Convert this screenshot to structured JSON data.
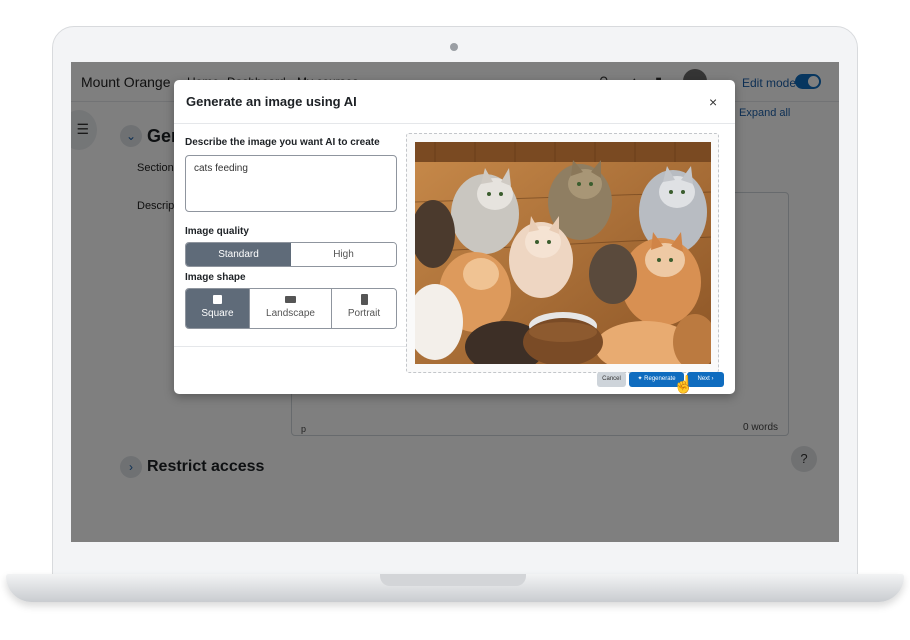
{
  "page": {
    "site_name": "Mount Orange",
    "nav": [
      "Home",
      "Dashboard",
      "My courses"
    ],
    "edit_mode_label": "Edit mode",
    "expand_all": "Expand all",
    "section_heading": "General",
    "labels": {
      "section": "Section",
      "description": "Description"
    },
    "editor": {
      "path": "p",
      "word_count": "0 words"
    },
    "restrict_access": "Restrict access",
    "help": "?"
  },
  "modal": {
    "title": "Generate an image using AI",
    "close": "×",
    "prompt_label": "Describe the image you want AI to create",
    "prompt_value": "cats feeding",
    "quality_label": "Image quality",
    "quality_options": [
      "Standard",
      "High"
    ],
    "quality_selected": "Standard",
    "shape_label": "Image shape",
    "shape_options": [
      "Square",
      "Landscape",
      "Portrait"
    ],
    "shape_selected": "Square",
    "buttons": {
      "cancel": "Cancel",
      "regenerate": "Regenerate",
      "next": "Next"
    }
  },
  "colors": {
    "accent": "#0f6cbf",
    "segment_active": "#5f6b79",
    "backdrop": "rgba(0,0,0,0.5)"
  },
  "icons": [
    "drawer-toggle-icon",
    "search-icon",
    "notifications-icon",
    "messages-icon",
    "close-icon",
    "chevron-down-icon",
    "chevron-right-icon",
    "square-shape-icon",
    "landscape-shape-icon",
    "portrait-shape-icon",
    "sparkle-icon",
    "hand-cursor-icon"
  ]
}
